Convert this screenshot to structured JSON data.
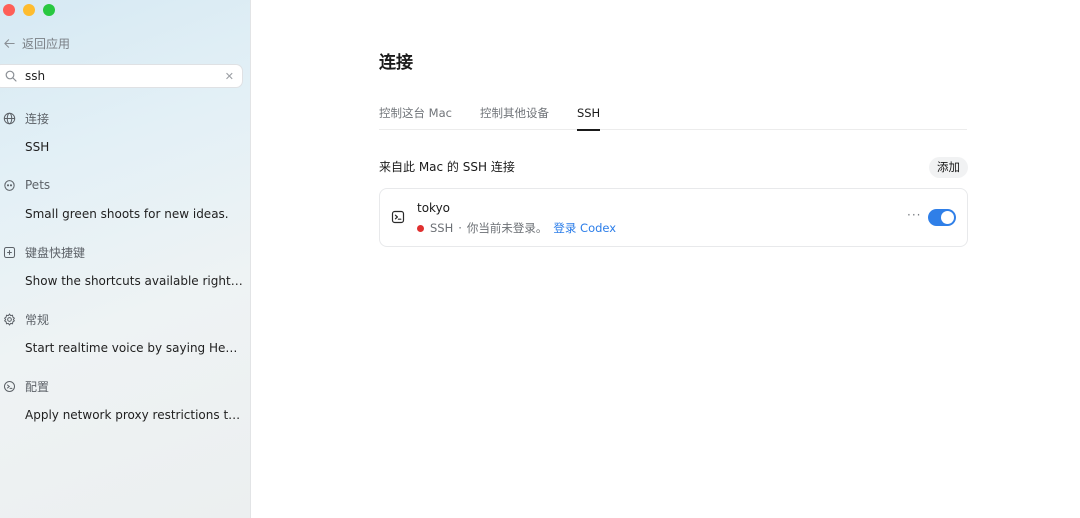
{
  "window": {
    "traffic_lights": [
      "#fe5f57",
      "#febc2e",
      "#28c840"
    ]
  },
  "sidebar": {
    "back_label": "返回应用",
    "search": {
      "value": "ssh",
      "placeholder": "",
      "clear_icon": "close-icon"
    },
    "results": [
      {
        "category": "连接",
        "icon": "globe-icon",
        "item": "SSH"
      },
      {
        "category": "Pets",
        "icon": "pet-face-icon",
        "item": "Small green shoots for new ideas."
      },
      {
        "category": "键盘快捷键",
        "icon": "keyboard-key-icon",
        "item": "Show the shortcuts available right ..."
      },
      {
        "category": "常规",
        "icon": "gear-icon",
        "item": "Start realtime voice by saying Hey ..."
      },
      {
        "category": "配置",
        "icon": "terminal-config-icon",
        "item": "Apply network proxy restrictions to..."
      }
    ]
  },
  "main": {
    "title": "连接",
    "tabs": [
      {
        "label": "控制这台 Mac",
        "active": false
      },
      {
        "label": "控制其他设备",
        "active": false
      },
      {
        "label": "SSH",
        "active": true
      }
    ],
    "section_title": "来自此 Mac 的 SSH 连接",
    "add_label": "添加",
    "connection": {
      "name": "tokyo",
      "icon": "terminal-icon",
      "status_color": "#e0302f",
      "protocol": "SSH",
      "separator": "·",
      "status_text": "你当前未登录。",
      "login_link": "登录 Codex",
      "more_label": "···",
      "enabled": true,
      "toggle_color": "#2f7fe8"
    }
  }
}
